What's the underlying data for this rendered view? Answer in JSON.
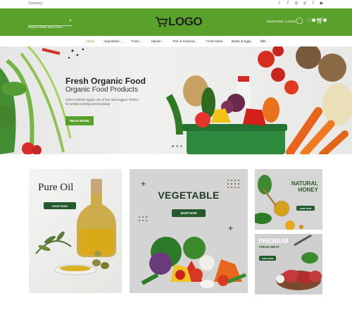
{
  "topbar": {
    "currency": "Currency",
    "socials": [
      "twitter-icon",
      "facebook-icon",
      "instagram-icon",
      "pinterest-icon",
      "facebook-square-icon",
      "youtube-icon"
    ]
  },
  "header": {
    "search_placeholder": "Search entire store here...",
    "logo_text": "LOGO",
    "account_link": "REGISTER / LOGIN",
    "wishlist_count": "0",
    "cart_count": "0"
  },
  "nav": [
    {
      "label": "Home",
      "active": true,
      "dropdown": false
    },
    {
      "label": "Vegetables",
      "active": false,
      "dropdown": true
    },
    {
      "label": "Fruits",
      "active": false,
      "dropdown": true
    },
    {
      "label": "Salads",
      "active": false,
      "dropdown": true
    },
    {
      "label": "Fish & Seafood",
      "active": false,
      "dropdown": true
    },
    {
      "label": "Fresh Meat",
      "active": false,
      "dropdown": false
    },
    {
      "label": "Butter & Eggs",
      "active": false,
      "dropdown": false
    },
    {
      "label": "Milk",
      "active": false,
      "dropdown": false
    }
  ],
  "hero": {
    "title": "Fresh Organic Food",
    "subtitle": "Organic Food Products",
    "description": "100% certified organic mix of fruit and veggies. Perfect for weekly cooking and snacking!",
    "button": "READ MORE"
  },
  "banners": {
    "oil": {
      "title": "Pure Oil",
      "button": "SHOP NOW"
    },
    "vegetable": {
      "title": "VEGETABLE",
      "button": "SHOP NOW"
    },
    "honey": {
      "title_line1": "NATURAL",
      "title_line2": "HONEY",
      "button": "SHOP NOW"
    },
    "meat": {
      "title": "PREMIUM",
      "subtitle": "FRESH MEAT",
      "button": "SHOP NOW"
    }
  },
  "colors": {
    "brand_green": "#5aa12b",
    "dark_green": "#245a2d"
  }
}
